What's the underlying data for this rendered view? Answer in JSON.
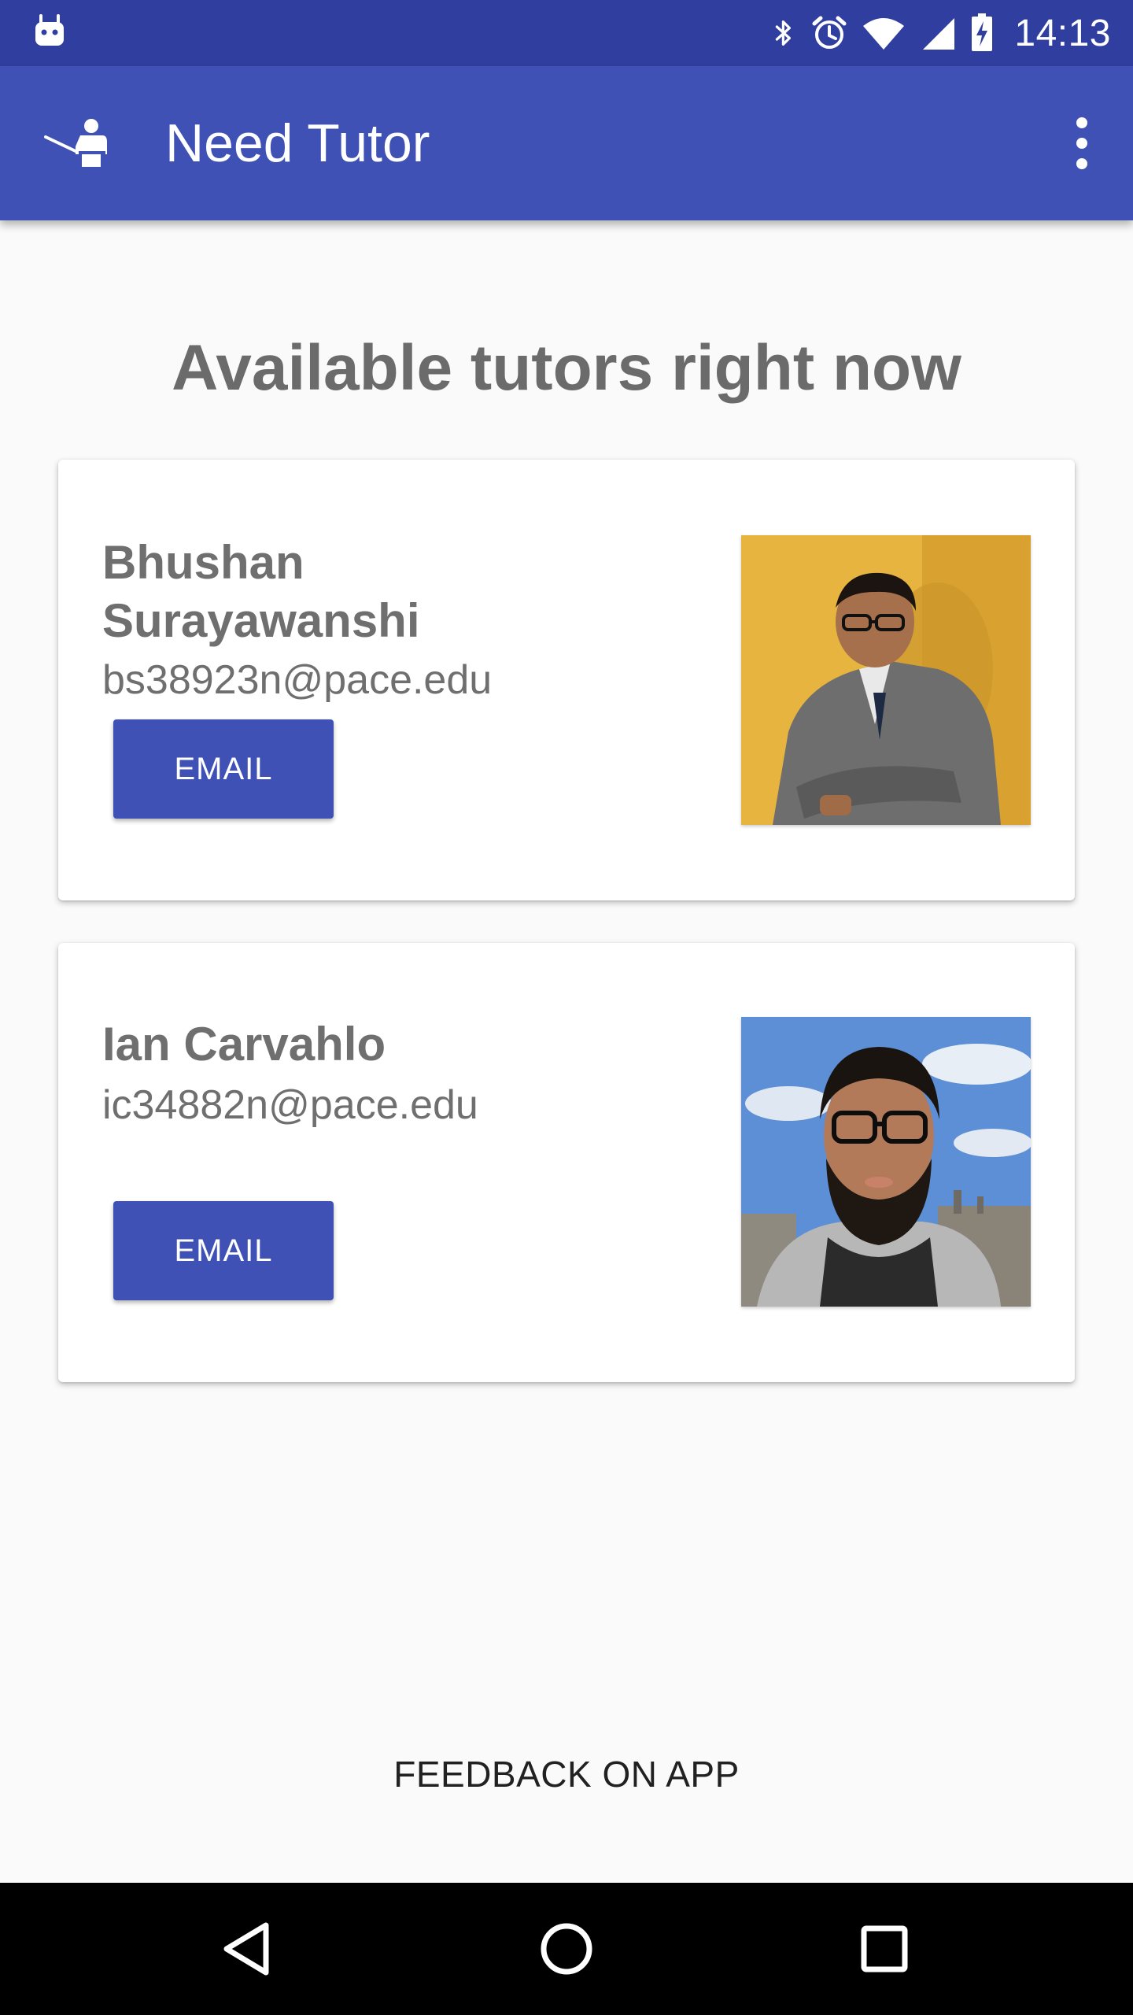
{
  "status_bar": {
    "time": "14:13",
    "left_icon": "android-notification-icon",
    "right_icons": [
      "bluetooth-icon",
      "alarm-icon",
      "wifi-icon",
      "signal-icon",
      "battery-charging-icon"
    ]
  },
  "app_bar": {
    "title": "Need Tutor",
    "logo_icon": "tutor-logo-icon",
    "menu_icon": "more-vert-icon"
  },
  "main": {
    "heading": "Available tutors right now",
    "tutors": [
      {
        "name": "Bhushan Surayawanshi",
        "email": "bs38923n@pace.edu",
        "button_label": "EMAIL"
      },
      {
        "name": "Ian Carvahlo",
        "email": "ic34882n@pace.edu",
        "button_label": "EMAIL"
      }
    ],
    "feedback_label": "FEEDBACK ON APP"
  },
  "nav_bar": {
    "icons": [
      "back-icon",
      "home-icon",
      "recents-icon"
    ]
  },
  "colors": {
    "status_bar": "#303f9f",
    "app_bar": "#3f51b5",
    "button": "#3f51b5",
    "background": "#fafafa",
    "text_gray": "#6f6f6f"
  }
}
